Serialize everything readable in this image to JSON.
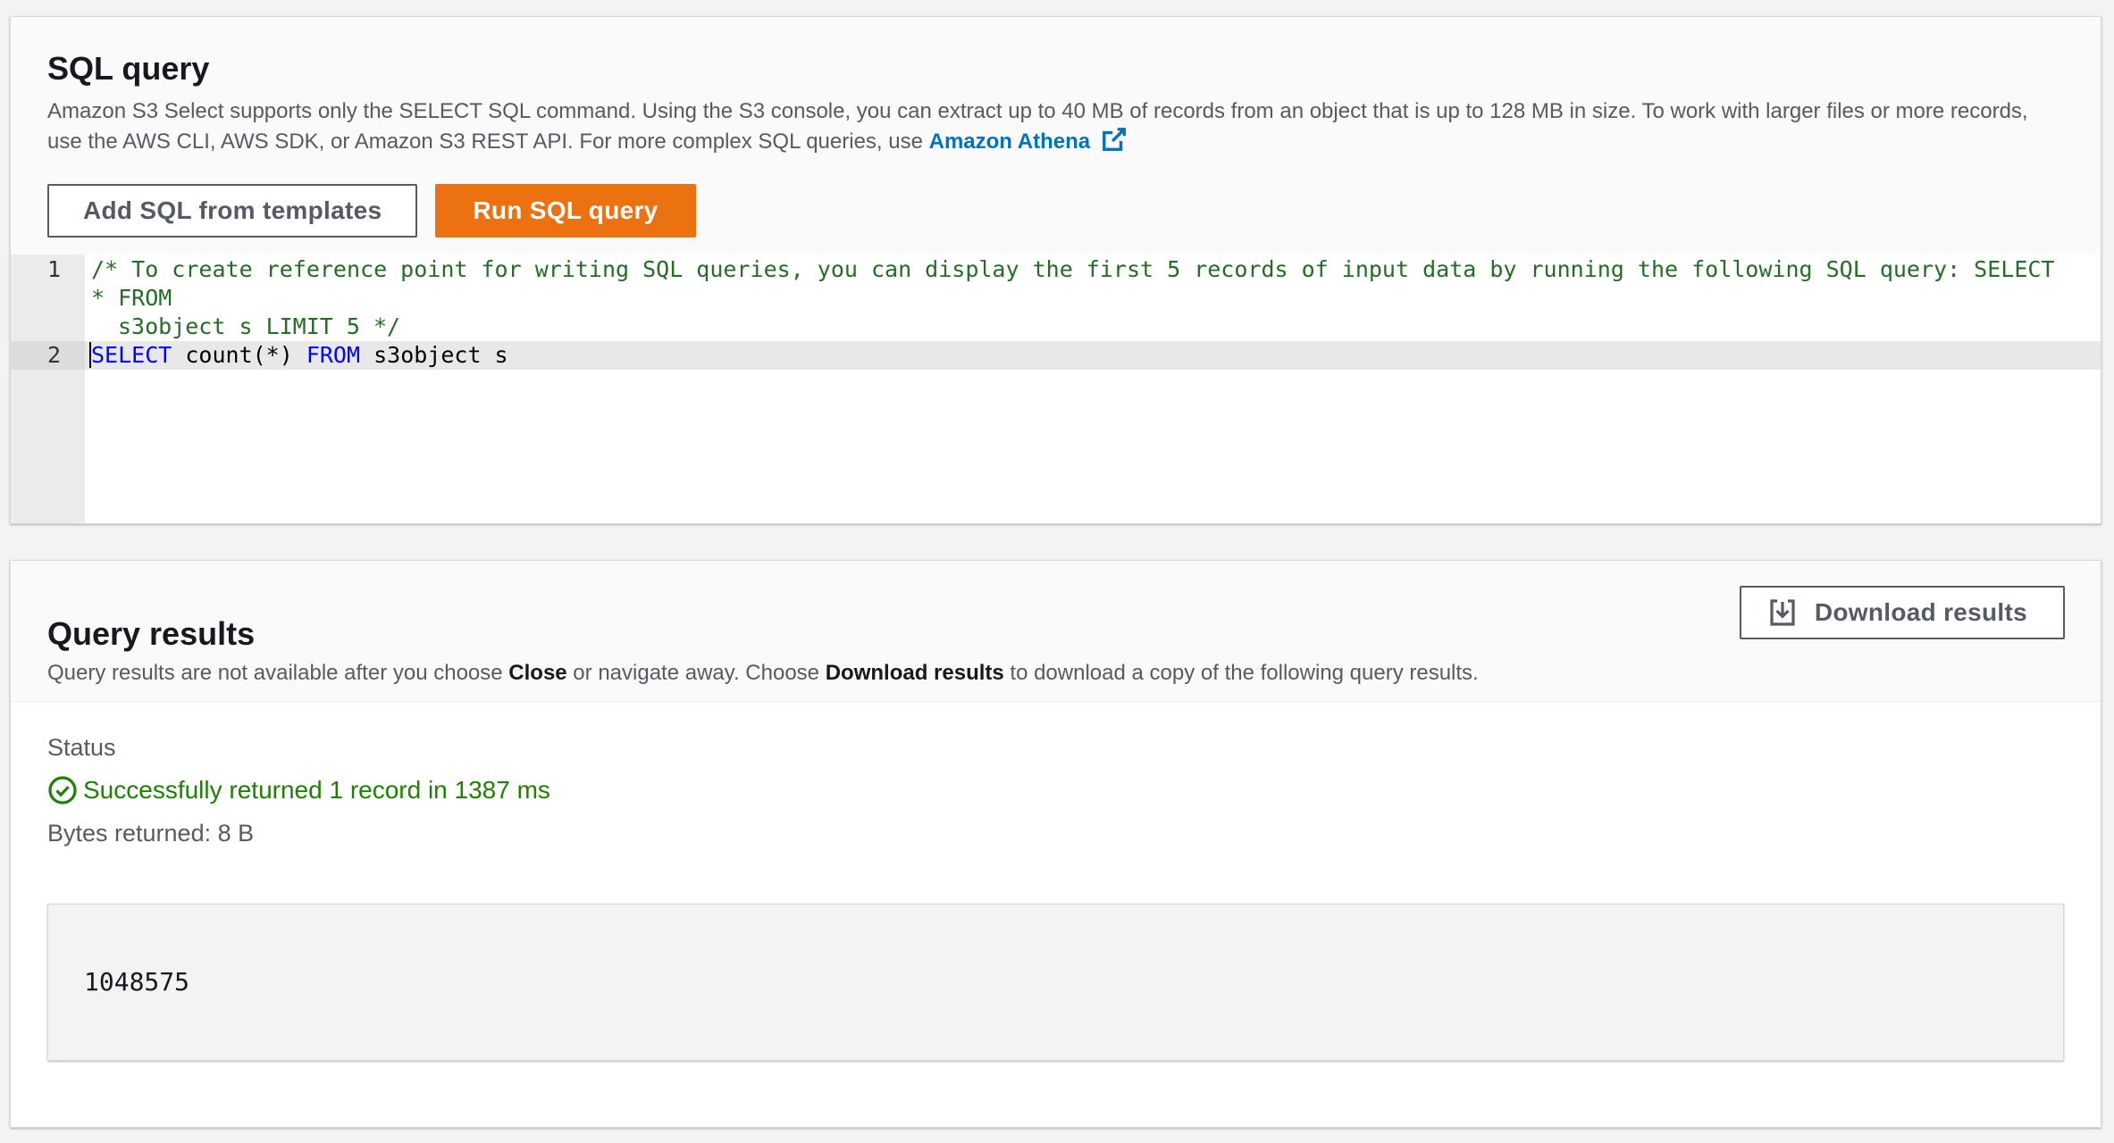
{
  "sql_panel": {
    "title": "SQL query",
    "description_text": "Amazon S3 Select supports only the SELECT SQL command. Using the S3 console, you can extract up to 40 MB of records from an object that is up to 128 MB in size. To work with larger files or more records, use the AWS CLI, AWS SDK, or Amazon S3 REST API. For more complex SQL queries, use ",
    "athena_link": "Amazon Athena",
    "add_templates_label": "Add SQL from templates",
    "run_query_label": "Run SQL query"
  },
  "editor": {
    "lines": [
      {
        "number": "1",
        "comment_part1": "/* To create reference point for writing SQL queries, you can display the first 5 records of input data by running the following SQL query: SELECT * FROM",
        "comment_part2": "s3object s LIMIT 5 */"
      },
      {
        "number": "2",
        "kw_select": "SELECT",
        "fn": " count(*) ",
        "kw_from": "FROM",
        "rest": " s3object s"
      }
    ]
  },
  "results_panel": {
    "title": "Query results",
    "desc_part1": "Query results are not available after you choose ",
    "desc_close": "Close",
    "desc_part2": " or navigate away. Choose ",
    "desc_download": "Download results",
    "desc_part3": " to download a copy of the following query results.",
    "download_label": "Download results",
    "status_label": "Status",
    "status_text": "Successfully returned 1 record in 1387 ms",
    "bytes_text": "Bytes returned: 8 B",
    "result_value": "1048575"
  },
  "colors": {
    "primary_button": "#ec7211",
    "link": "#0073bb",
    "success": "#1d8102",
    "comment": "#236e24",
    "keyword": "#0000ff"
  },
  "icons": {
    "external_link": "external-link-icon",
    "download": "download-icon",
    "status_success": "check-circle-icon"
  }
}
